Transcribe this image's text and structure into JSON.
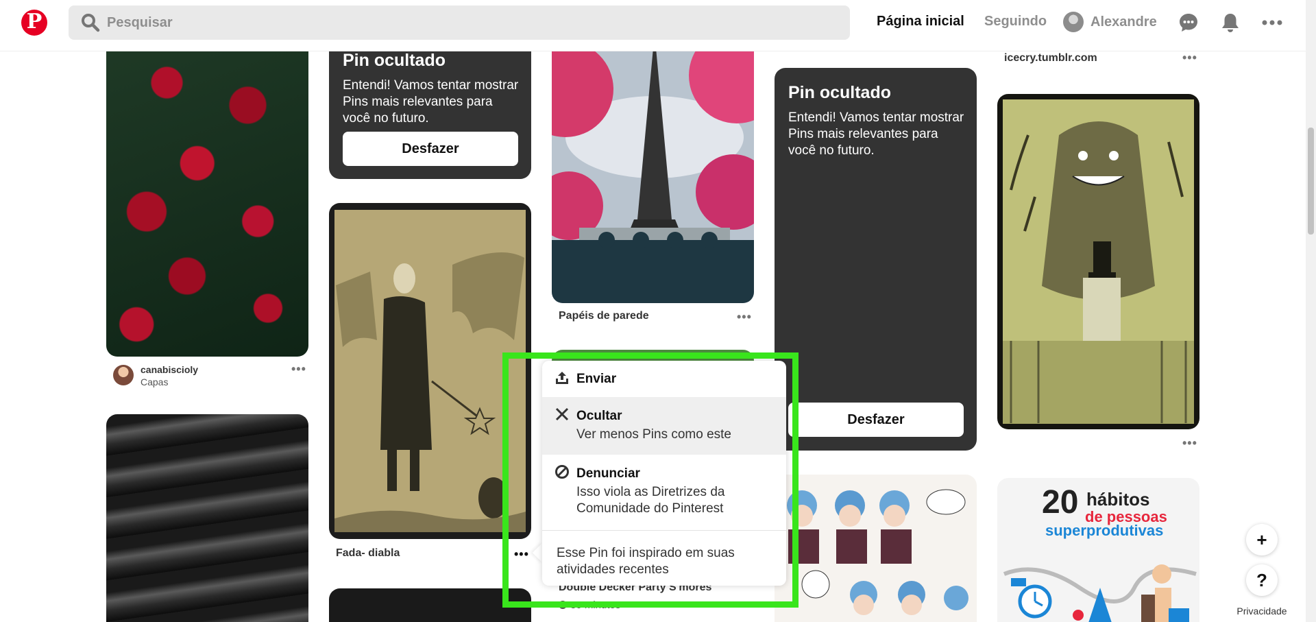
{
  "header": {
    "search_placeholder": "Pesquisar",
    "nav_home": "Página inicial",
    "nav_following": "Seguindo",
    "user_name": "Alexandre",
    "logo_letter": "P"
  },
  "pins": {
    "roses": {
      "author": "canabiscioly",
      "board": "Capas"
    },
    "hidden_top": {
      "title": "Pin ocultado",
      "message": "Entendi! Vamos tentar mostrar Pins mais relevantes para você no futuro.",
      "undo": "Desfazer"
    },
    "bat": {
      "title": "Fada- diabla"
    },
    "paris": {
      "title": "Papéis de parede"
    },
    "smores": {
      "title": "Double Decker Party S'mores",
      "time": "30 minutos"
    },
    "hidden_right": {
      "title": "Pin ocultado",
      "message": "Entendi! Vamos tentar mostrar Pins mais relevantes para você no futuro.",
      "undo": "Desfazer"
    },
    "tumblr": {
      "title": "icecry.tumblr.com"
    },
    "infographic": {
      "number": "20",
      "word1": "hábitos",
      "word2": "de pessoas",
      "word3": "superprodutivas"
    }
  },
  "menu": {
    "send": "Enviar",
    "hide_label": "Ocultar",
    "hide_sub": "Ver menos Pins como este",
    "report_label": "Denunciar",
    "report_sub": "Isso viola as Diretrizes da Comunidade do Pinterest",
    "inspired": "Esse Pin foi inspirado em suas atividades recentes"
  },
  "footer": {
    "add": "+",
    "help": "?",
    "privacy": "Privacidade"
  },
  "colors": {
    "brand": "#e60023",
    "highlight": "#39e51c",
    "card_dark": "#333333"
  }
}
